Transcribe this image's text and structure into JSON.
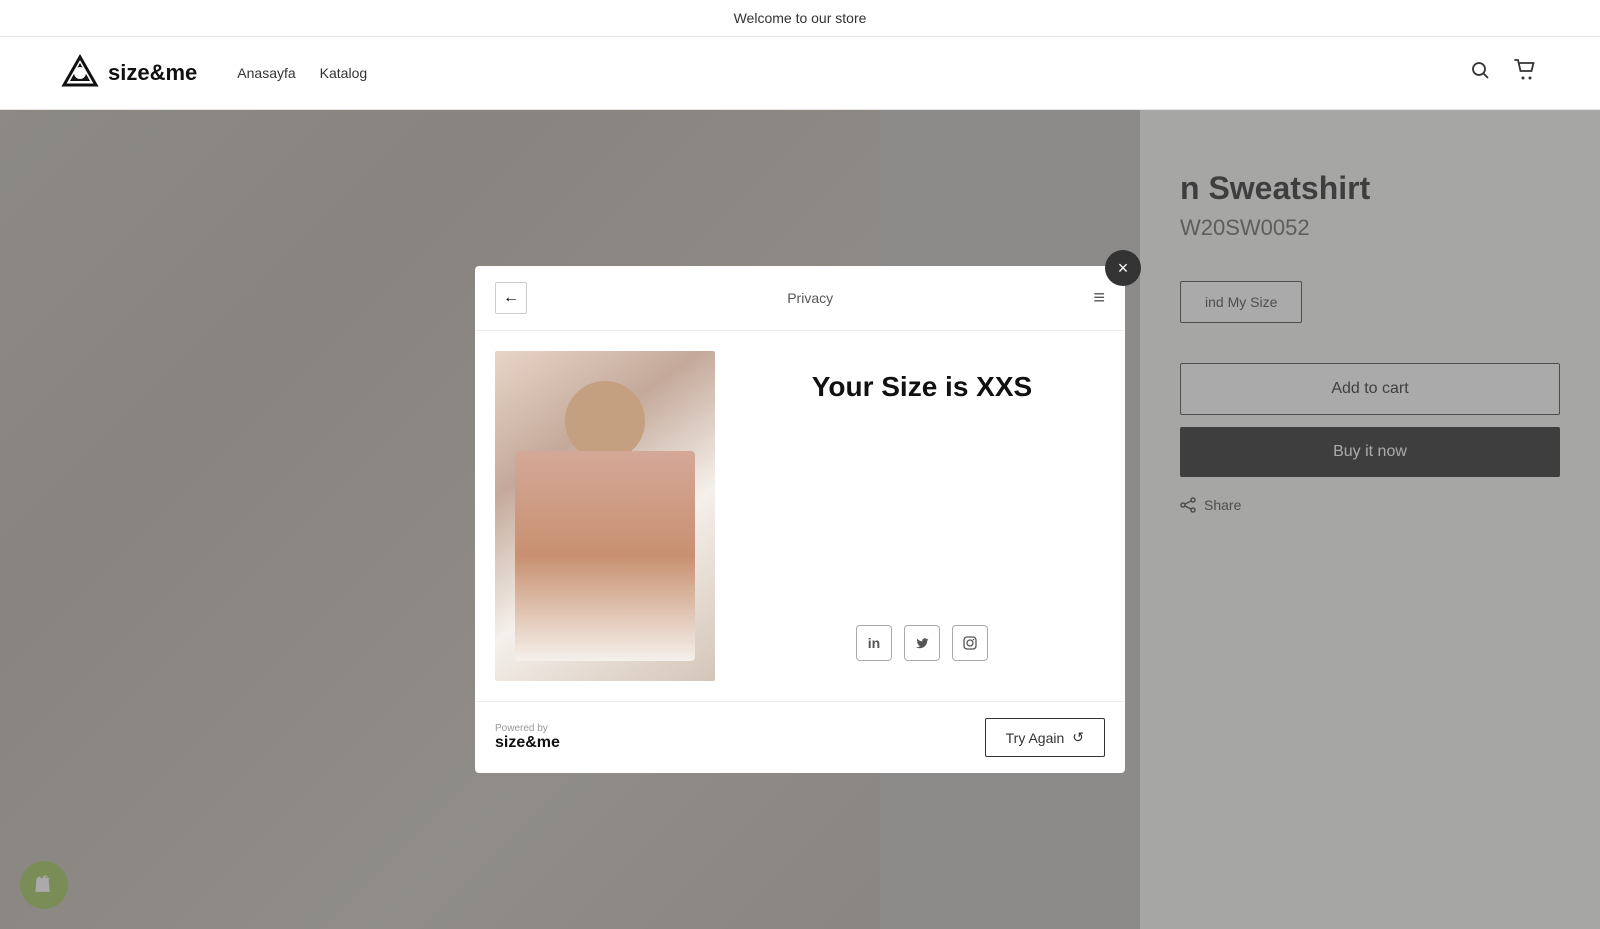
{
  "announcement": {
    "text": "Welcome to our store"
  },
  "header": {
    "logo_text": "size&me",
    "nav": [
      {
        "label": "Anasayfa"
      },
      {
        "label": "Katalog"
      }
    ],
    "search_label": "Search",
    "cart_label": "Cart"
  },
  "product": {
    "title": "n Sweatshirt",
    "sku": "W20SW0052",
    "find_size_label": "ind My Size",
    "add_to_cart_label": "Add to cart",
    "buy_now_label": "Buy it now",
    "share_label": "Share"
  },
  "modal": {
    "back_label": "←",
    "privacy_label": "Privacy",
    "menu_label": "≡",
    "close_label": "×",
    "size_result_title": "Your Size is XXS",
    "social": [
      {
        "name": "linkedin",
        "label": "in"
      },
      {
        "name": "twitter",
        "label": "𝕏"
      },
      {
        "name": "instagram",
        "label": "◻"
      }
    ],
    "powered_by_text": "Powered by",
    "powered_by_brand": "size&me",
    "try_again_label": "Try Again",
    "try_again_icon": "↺"
  },
  "shopify_badge": "🛍"
}
